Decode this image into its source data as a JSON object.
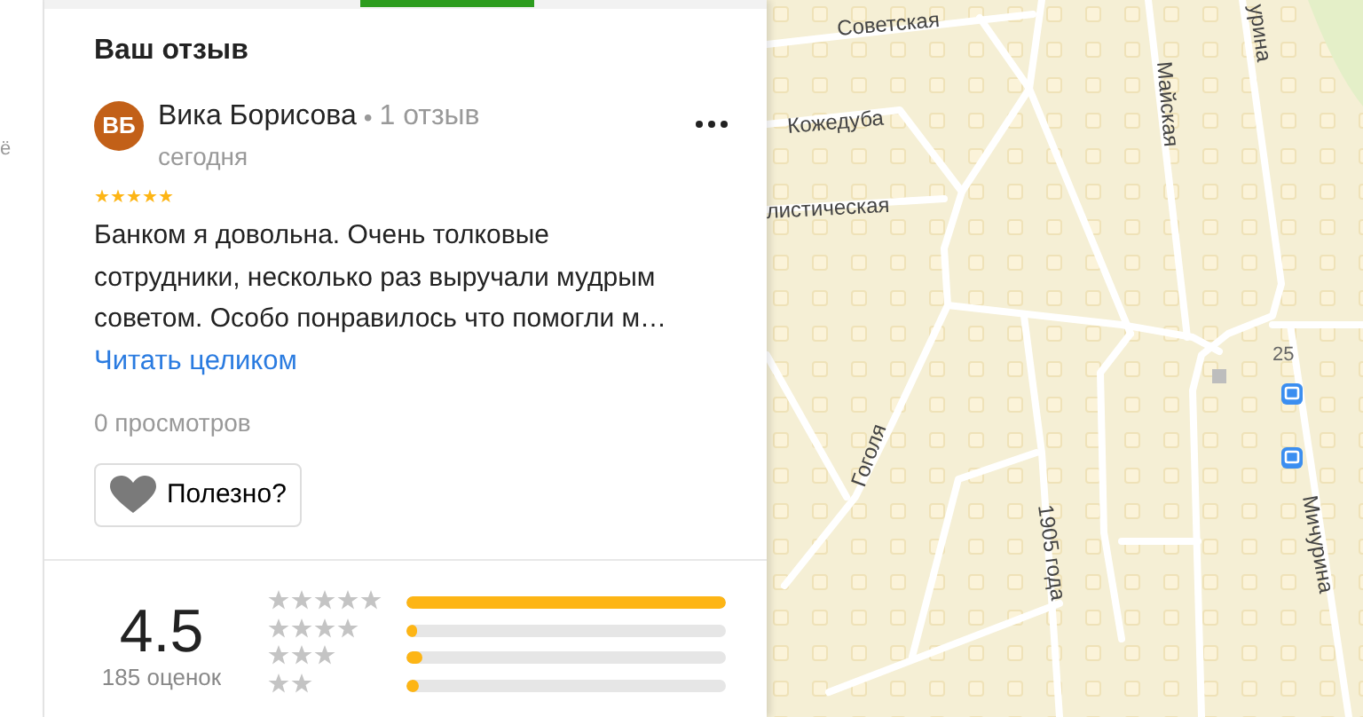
{
  "edge_fragment": "ё",
  "review": {
    "heading": "Ваш отзыв",
    "author": {
      "initials": "ВБ",
      "name": "Вика Борисова",
      "separator": "•",
      "review_count": "1 отзыв",
      "date": "сегодня"
    },
    "stars": 5,
    "text": "Банком я довольна. Очень толковые сотрудники, несколько раз выручали мудрым советом. Особо понравилось что помогли м…",
    "read_more": "Читать целиком",
    "views": "0 просмотров",
    "helpful_button": "Полезно?"
  },
  "summary": {
    "score": "4.5",
    "count": "185 оценок",
    "distribution": [
      {
        "kind": "five",
        "level": 1
      },
      {
        "kind": "four",
        "level": 0.02
      },
      {
        "kind": "three",
        "level": 0.05
      },
      {
        "kind": "two",
        "level": 0.04
      }
    ]
  },
  "map": {
    "street_labels": [
      {
        "text": "Советская",
        "kind": "street"
      },
      {
        "text": "Кожедуба",
        "kind": "street"
      },
      {
        "text": "листическая",
        "kind": "street"
      },
      {
        "text": "Майская",
        "kind": "street"
      },
      {
        "text": "урина",
        "kind": "street"
      },
      {
        "text": "Гоголя",
        "kind": "street"
      },
      {
        "text": "1905 года",
        "kind": "street"
      },
      {
        "text": "Мичурина",
        "kind": "street"
      },
      {
        "text": "25",
        "kind": "house"
      }
    ]
  }
}
